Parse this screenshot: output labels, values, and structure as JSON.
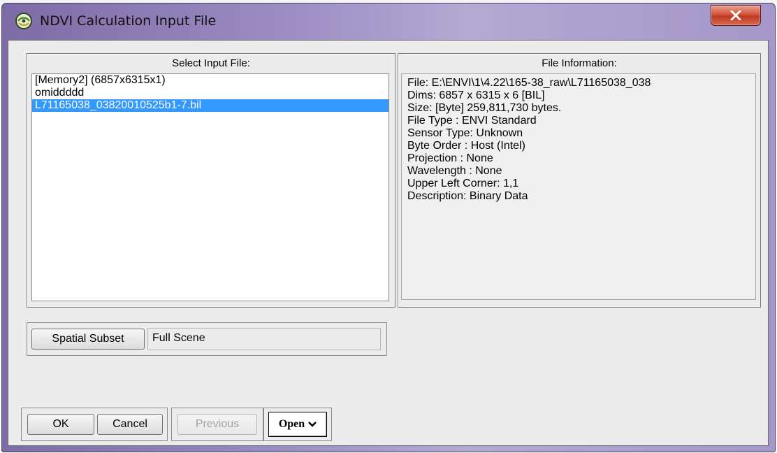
{
  "window": {
    "title": "NDVI Calculation Input File",
    "close_glyph": "x"
  },
  "input_panel": {
    "title": "Select Input File:",
    "files": [
      "[Memory2] (6857x6315x1)",
      "omiddddd",
      "L71165038_03820010525b1-7.bil"
    ],
    "selected_index": 2
  },
  "info_panel": {
    "title": "File Information:",
    "lines": [
      "File: E:\\ENVI\\1\\4.22\\165-38_raw\\L71165038_038",
      "Dims: 6857 x 6315 x 6 [BIL]",
      "Size: [Byte] 259,811,730 bytes.",
      "File Type  : ENVI Standard",
      "Sensor Type: Unknown",
      "Byte Order : Host (Intel)",
      "Projection : None",
      "Wavelength : None",
      "Upper Left Corner: 1,1",
      "Description: Binary Data"
    ]
  },
  "subset": {
    "button_label": "Spatial Subset",
    "value": "Full Scene"
  },
  "buttons": {
    "ok": "OK",
    "cancel": "Cancel",
    "previous": "Previous",
    "open": "Open"
  },
  "icons": {
    "app": "envi-globe-icon",
    "close": "close-icon",
    "dropdown": "dropdown-arrow-icon"
  },
  "colors": {
    "selection": "#3399ff",
    "close_button": "#c8452e"
  }
}
